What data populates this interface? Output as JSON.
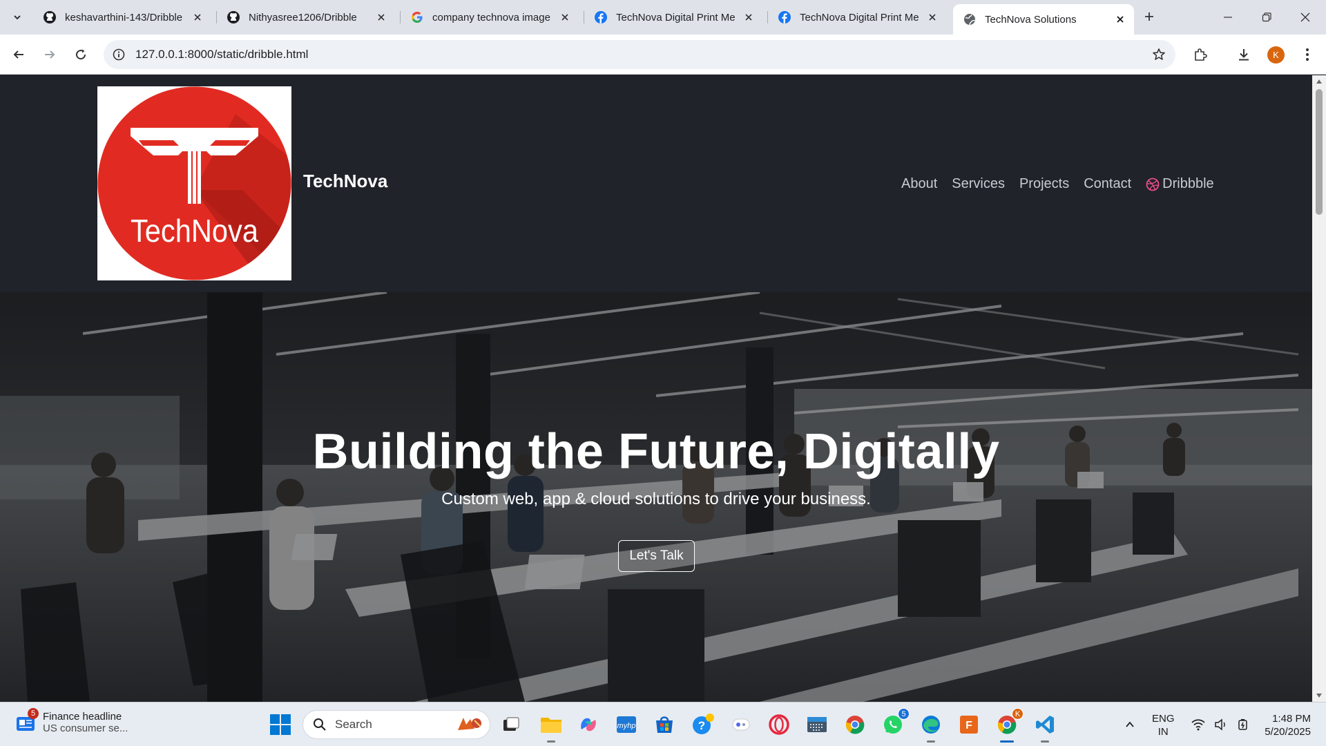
{
  "browser": {
    "tabs": [
      {
        "title": "keshavarthini-143/Dribble",
        "icon": "github-icon",
        "active": false
      },
      {
        "title": "Nithyasree1206/Dribble",
        "icon": "github-icon",
        "active": false
      },
      {
        "title": "company technova image",
        "icon": "google-icon",
        "active": false
      },
      {
        "title": "TechNova Digital Print Me",
        "icon": "facebook-icon",
        "active": false
      },
      {
        "title": "TechNova Digital Print Me",
        "icon": "facebook-icon",
        "active": false
      },
      {
        "title": "TechNova Solutions",
        "icon": "globe-icon",
        "active": true
      }
    ],
    "url": "127.0.0.1:8000/static/dribble.html",
    "profile_initial": "K"
  },
  "site": {
    "logo_text": "TechNova",
    "brand_name": "TechNova",
    "nav": [
      "About",
      "Services",
      "Projects",
      "Contact"
    ],
    "nav_dribbble": "Dribbble",
    "hero": {
      "title": "Building the Future, Digitally",
      "subtitle": "Custom web, app & cloud solutions to drive your business.",
      "cta": "Let's Talk"
    }
  },
  "taskbar": {
    "news": {
      "badge": "5",
      "title": "Finance headline",
      "subtitle": "US consumer se..."
    },
    "search_label": "Search",
    "whatsapp_badge": "5",
    "chrome_badge": "K",
    "lang": {
      "line1": "ENG",
      "line2": "IN"
    },
    "clock": {
      "time": "1:48 PM",
      "date": "5/20/2025"
    }
  },
  "colors": {
    "header_bg": "#20232a",
    "logo_red": "#e12b22",
    "nav_text": "#c7ccd3",
    "dribbble_pink": "#ea4c89"
  }
}
